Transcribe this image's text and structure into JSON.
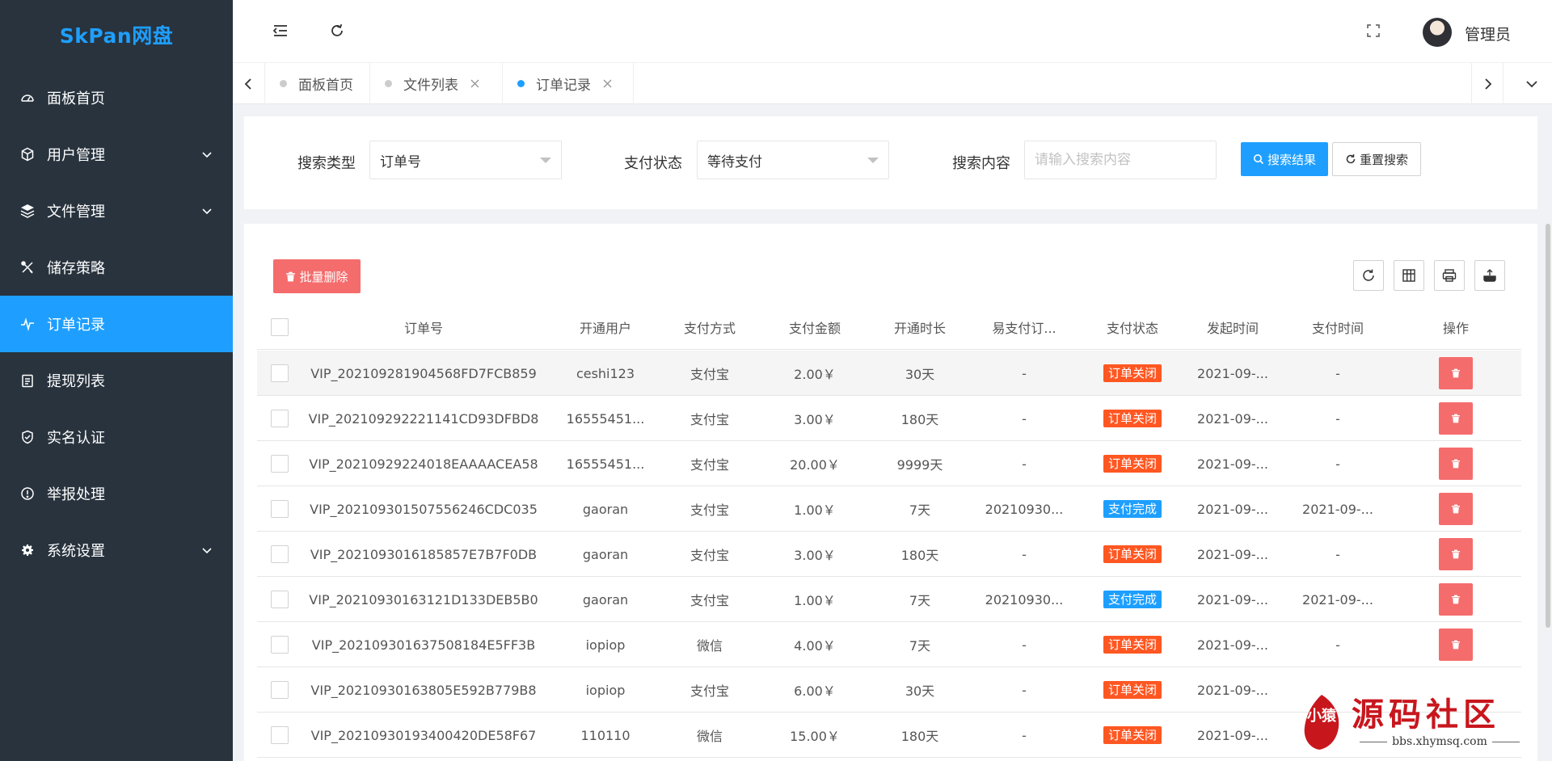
{
  "app": {
    "logo": "SkPan网盘"
  },
  "sidebar": {
    "items": [
      {
        "label": "面板首页",
        "icon": "dashboard-icon",
        "has_children": false,
        "active": false
      },
      {
        "label": "用户管理",
        "icon": "cube-icon",
        "has_children": true,
        "active": false
      },
      {
        "label": "文件管理",
        "icon": "layers-icon",
        "has_children": true,
        "active": false
      },
      {
        "label": "储存策略",
        "icon": "tools-icon",
        "has_children": false,
        "active": false
      },
      {
        "label": "订单记录",
        "icon": "pulse-icon",
        "has_children": false,
        "active": true
      },
      {
        "label": "提现列表",
        "icon": "clipboard-icon",
        "has_children": false,
        "active": false
      },
      {
        "label": "实名认证",
        "icon": "shield-check-icon",
        "has_children": false,
        "active": false
      },
      {
        "label": "举报处理",
        "icon": "info-circle-icon",
        "has_children": false,
        "active": false
      },
      {
        "label": "系统设置",
        "icon": "gear-icon",
        "has_children": true,
        "active": false
      }
    ]
  },
  "header": {
    "admin_name": "管理员"
  },
  "tabs": [
    {
      "label": "面板首页",
      "closable": false,
      "active": false
    },
    {
      "label": "文件列表",
      "closable": true,
      "active": false
    },
    {
      "label": "订单记录",
      "closable": true,
      "active": true
    }
  ],
  "search": {
    "type_label": "搜索类型",
    "type_value": "订单号",
    "status_label": "支付状态",
    "status_value": "等待支付",
    "content_label": "搜索内容",
    "content_placeholder": "请输入搜索内容",
    "search_button": "搜索结果",
    "reset_button": "重置搜索"
  },
  "table": {
    "batch_delete_label": "批量删除",
    "columns": [
      "订单号",
      "开通用户",
      "支付方式",
      "支付金额",
      "开通时长",
      "易支付订...",
      "支付状态",
      "发起时间",
      "支付时间",
      "操作"
    ],
    "rows": [
      {
        "order_no": "VIP_202109281904568FD7FCB859",
        "user": "ceshi123",
        "method": "支付宝",
        "amount": "2.00￥",
        "duration": "30天",
        "epay_order": "-",
        "status": "订单关闭",
        "status_kind": "closed",
        "created": "2021-09-...",
        "paid": "-"
      },
      {
        "order_no": "VIP_202109292221141CD93DFBD8",
        "user": "16555451...",
        "method": "支付宝",
        "amount": "3.00￥",
        "duration": "180天",
        "epay_order": "-",
        "status": "订单关闭",
        "status_kind": "closed",
        "created": "2021-09-...",
        "paid": "-"
      },
      {
        "order_no": "VIP_20210929224018EAAAACEA58",
        "user": "16555451...",
        "method": "支付宝",
        "amount": "20.00￥",
        "duration": "9999天",
        "epay_order": "-",
        "status": "订单关闭",
        "status_kind": "closed",
        "created": "2021-09-...",
        "paid": "-"
      },
      {
        "order_no": "VIP_20210930150755624​6CDC035",
        "user": "gaoran",
        "method": "支付宝",
        "amount": "1.00￥",
        "duration": "7天",
        "epay_order": "20210930...",
        "status": "支付完成",
        "status_kind": "done",
        "created": "2021-09-...",
        "paid": "2021-09-..."
      },
      {
        "order_no": "VIP_20210930161858​57E7B7F0DB",
        "user": "gaoran",
        "method": "支付宝",
        "amount": "3.00￥",
        "duration": "180天",
        "epay_order": "-",
        "status": "订单关闭",
        "status_kind": "closed",
        "created": "2021-09-...",
        "paid": "-"
      },
      {
        "order_no": "VIP_20210930163121D133DEB5B0",
        "user": "gaoran",
        "method": "支付宝",
        "amount": "1.00￥",
        "duration": "7天",
        "epay_order": "20210930...",
        "status": "支付完成",
        "status_kind": "done",
        "created": "2021-09-...",
        "paid": "2021-09-..."
      },
      {
        "order_no": "VIP_202109301637508184E5FF3B",
        "user": "iopiop",
        "method": "微信",
        "amount": "4.00￥",
        "duration": "7天",
        "epay_order": "-",
        "status": "订单关闭",
        "status_kind": "closed",
        "created": "2021-09-...",
        "paid": "-"
      },
      {
        "order_no": "VIP_20210930163805E592B779B8",
        "user": "iopiop",
        "method": "支付宝",
        "amount": "6.00￥",
        "duration": "30天",
        "epay_order": "-",
        "status": "订单关闭",
        "status_kind": "closed",
        "created": "2021-09-...",
        "paid": ""
      },
      {
        "order_no": "VIP_20210930193400420DE58F67",
        "user": "110110",
        "method": "微信",
        "amount": "15.00￥",
        "duration": "180天",
        "epay_order": "-",
        "status": "订单关闭",
        "status_kind": "closed",
        "created": "2021-09-...",
        "paid": ""
      }
    ]
  },
  "watermark": {
    "title": "源码社区",
    "url": "bbs.xhymsq.com",
    "seal_text": "小猿"
  },
  "colors": {
    "primary": "#1e9fff",
    "danger": "#f56c6c",
    "status_closed": "#ff5722",
    "status_done": "#1e9fff",
    "sidebar_bg": "#28333e"
  }
}
